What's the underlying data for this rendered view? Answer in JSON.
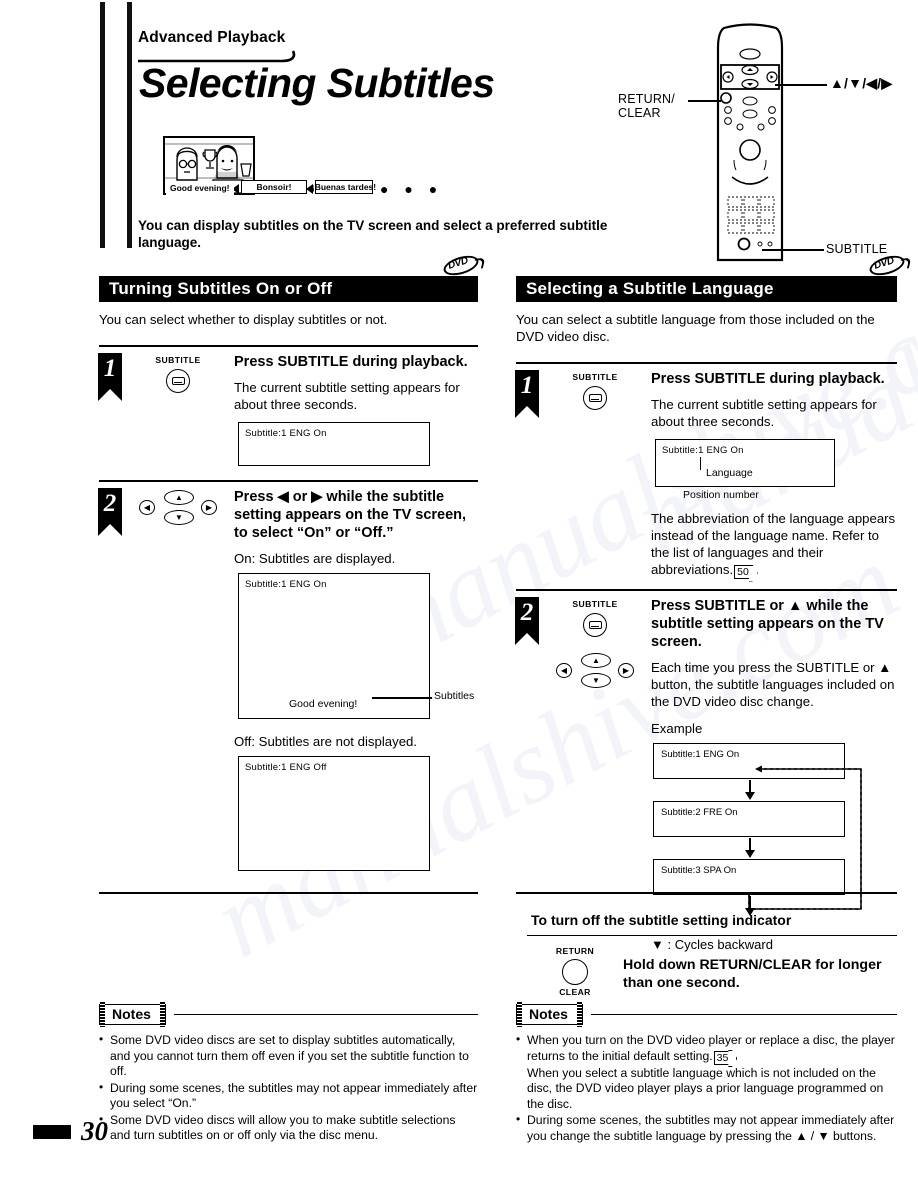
{
  "document": {
    "tagline": "Advanced Playback",
    "title": "Selecting Subtitles",
    "intro": "You can display subtitles on the TV screen and select a preferred subtitle language.",
    "page_number": "30"
  },
  "illustration": {
    "subtitle_english": "Good evening!",
    "subtitle_french": "Bonsoir!",
    "subtitle_spanish": "¡Buenas tardes!",
    "ellipsis": "●  ●  ●"
  },
  "remote": {
    "label_return_clear": "RETURN/\nCLEAR",
    "label_arrows": "▲/▼/◀/▶",
    "label_subtitle": "SUBTITLE"
  },
  "badges": {
    "dvd": "DVD"
  },
  "left_section": {
    "heading": "Turning Subtitles On or Off",
    "intro": "You can select whether to display subtitles or not.",
    "steps": [
      {
        "number": "1",
        "icon_caption": "SUBTITLE",
        "icon_name": "subtitle-button-icon",
        "title": "Press SUBTITLE during playback.",
        "description": "The current subtitle setting appears for about three seconds.",
        "screen": {
          "osd": "Subtitle:1  ENG  On"
        }
      },
      {
        "number": "2",
        "icon_name": "dpad-icon",
        "title": "Press ◀ or ▶ while the subtitle setting appears on the TV screen, to select “On” or “Off.”",
        "on_label": "On: Subtitles are displayed.",
        "on_screen": {
          "osd": "Subtitle:1  ENG  On",
          "caption": "Good evening!",
          "pointer_label": "Subtitles"
        },
        "off_label": "Off: Subtitles are not displayed.",
        "off_screen": {
          "osd": "Subtitle:1  ENG  Off"
        }
      }
    ],
    "notes_title": "Notes",
    "notes": [
      "Some DVD video discs are set to display subtitles automatically, and you cannot turn them off even if you set the subtitle function to off.",
      "During some scenes, the subtitles may not appear immediately after you select “On.”",
      "Some DVD video discs will allow you to make subtitle selections and turn subtitles on or off only via the disc menu."
    ]
  },
  "right_section": {
    "heading": "Selecting a Subtitle Language",
    "intro": "You can select a subtitle language from those included on the DVD video disc.",
    "steps": [
      {
        "number": "1",
        "icon_caption": "SUBTITLE",
        "icon_name": "subtitle-button-icon",
        "title": "Press SUBTITLE during playback.",
        "description": "The current subtitle setting appears for about three seconds.",
        "screen": {
          "osd": "Subtitle:1  ENG  On",
          "callout_language": "Language",
          "callout_position": "Position number"
        },
        "after_note": "The abbreviation of the language appears instead of the language name. Refer to the list of languages and their abbreviations.",
        "after_note_pageref": "50"
      },
      {
        "number": "2",
        "icon_caption": "SUBTITLE",
        "icon_name": "subtitle-button-icon",
        "title": "Press SUBTITLE or ▲ while the subtitle setting appears on the TV screen.",
        "description": "Each time you press the SUBTITLE or ▲ button, the subtitle languages included on the DVD video disc change.",
        "example_label": "Example",
        "cycle": [
          "Subtitle:1  ENG  On",
          "Subtitle:2  FRE  On",
          "Subtitle:3  SPA  On"
        ],
        "cycle_legend": "▼ : Cycles backward"
      }
    ],
    "subheading": "To turn off the subtitle setting indicator",
    "subheading_icon_top": "RETURN",
    "subheading_icon_bottom": "CLEAR",
    "subheading_instruction": "Hold down RETURN/CLEAR for longer than one second.",
    "notes_title": "Notes",
    "notes": [
      {
        "text_before": "When you turn on the DVD video player or replace a disc, the player returns to the initial default setting.",
        "pageref": "35",
        "text_after": "When you select a subtitle language which is not included on the disc, the DVD video player plays a prior language programmed on the disc."
      },
      {
        "text_before": "During some scenes, the subtitles may not appear immediately after you change the subtitle language by pressing the ▲ / ▼ buttons.",
        "pageref": "",
        "text_after": ""
      }
    ]
  },
  "watermark": {
    "text": "manualshive.com"
  }
}
